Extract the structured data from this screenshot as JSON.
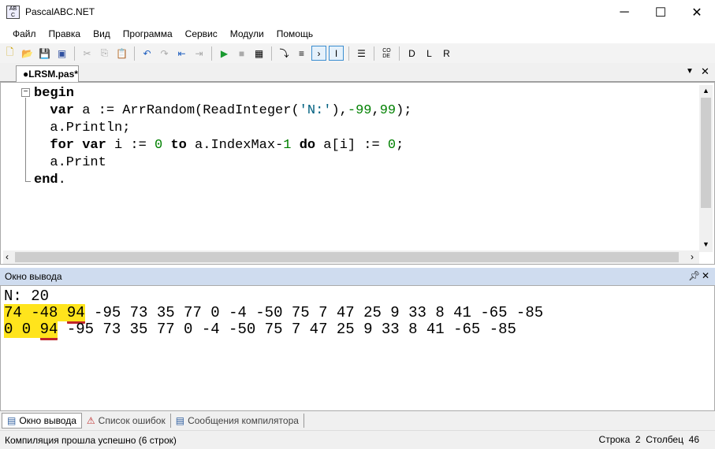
{
  "window": {
    "title": "PascalABC.NET",
    "minimize": "─",
    "maximize": "☐",
    "close": "✕"
  },
  "menu": [
    "Файл",
    "Правка",
    "Вид",
    "Программа",
    "Сервис",
    "Модули",
    "Помощь"
  ],
  "tab": {
    "label": "●LRSM.pas*"
  },
  "code": [
    [
      {
        "t": "begin",
        "c": "kw"
      }
    ],
    [
      {
        "t": "  "
      },
      {
        "t": "var",
        "c": "kw"
      },
      {
        "t": " a := ArrRandom(ReadInteger("
      },
      {
        "t": "'N:'",
        "c": "str"
      },
      {
        "t": "),"
      },
      {
        "t": "-99",
        "c": "num"
      },
      {
        "t": ","
      },
      {
        "t": "99",
        "c": "num"
      },
      {
        "t": ");"
      }
    ],
    [
      {
        "t": "  a.Println;"
      }
    ],
    [
      {
        "t": "  "
      },
      {
        "t": "for",
        "c": "kw"
      },
      {
        "t": " "
      },
      {
        "t": "var",
        "c": "kw"
      },
      {
        "t": " i := "
      },
      {
        "t": "0",
        "c": "num"
      },
      {
        "t": " "
      },
      {
        "t": "to",
        "c": "kw"
      },
      {
        "t": " a.IndexMax-"
      },
      {
        "t": "1",
        "c": "num"
      },
      {
        "t": " "
      },
      {
        "t": "do",
        "c": "kw"
      },
      {
        "t": " a[i] := "
      },
      {
        "t": "0",
        "c": "num"
      },
      {
        "t": ";"
      }
    ],
    [
      {
        "t": "  a.Print"
      }
    ],
    [
      {
        "t": "end",
        "c": "kw"
      },
      {
        "t": "."
      }
    ]
  ],
  "output": {
    "title": "Окно вывода",
    "prompt": "N: 20",
    "line1": {
      "hl_a": "74 -48 ",
      "hl_b": "94",
      "rest": " -95 73 35 77 0 -4 -50 75 7 47 25 9 33 8 41 -65 -85"
    },
    "line2": {
      "hl_a": "0 0 ",
      "hl_b": "94",
      "rest": " -95 73 35 77 0 -4 -50 75 7 47 25 9 33 8 41 -65 -85"
    }
  },
  "bottom_tabs": [
    "Окно вывода",
    "Список ошибок",
    "Сообщения компилятора"
  ],
  "status": {
    "message": "Компиляция прошла успешно (6 строк)",
    "position": "Строка  2  Столбец  46"
  }
}
